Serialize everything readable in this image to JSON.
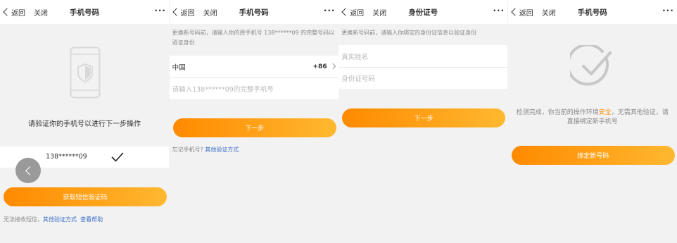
{
  "common": {
    "back_label": "返回",
    "close_label": "关闭",
    "more_label": "···"
  },
  "screen1": {
    "title": "手机号码",
    "prompt": "请验证你的手机号以进行下一步操作",
    "masked_phone": "138******09",
    "button": "获取短信验证码",
    "footer_text": "无法接收短信，",
    "footer_link1": "其他验证方式",
    "footer_link2": "查看帮助"
  },
  "screen2": {
    "title": "手机号码",
    "hint": "更换新号码前，请输入你的原手机号 138******09 的完整号码以验证身份",
    "country": "中国",
    "country_code": "+86",
    "phone_placeholder": "请输入138******09的完整手机号",
    "button": "下一步",
    "footer_text": "忘记手机号?",
    "footer_link": "其他验证方式"
  },
  "screen3": {
    "title": "身份证号",
    "hint": "更换新号码前，请输入你绑定的身份证信息以验证身份",
    "name_placeholder": "真实姓名",
    "id_placeholder": "身份证号码",
    "button": "下一步"
  },
  "screen4": {
    "title": "手机号码",
    "msg_part1": "检测完成，你当前的操作环境",
    "msg_safe": "安全",
    "msg_part2": "，无需其他验证，请直接绑定新手机号",
    "button": "绑定新号码"
  },
  "colors": {
    "accent_start": "#ff8a00",
    "accent_end": "#ffb830",
    "link": "#3b6ec7",
    "safe": "#ff8a00"
  }
}
